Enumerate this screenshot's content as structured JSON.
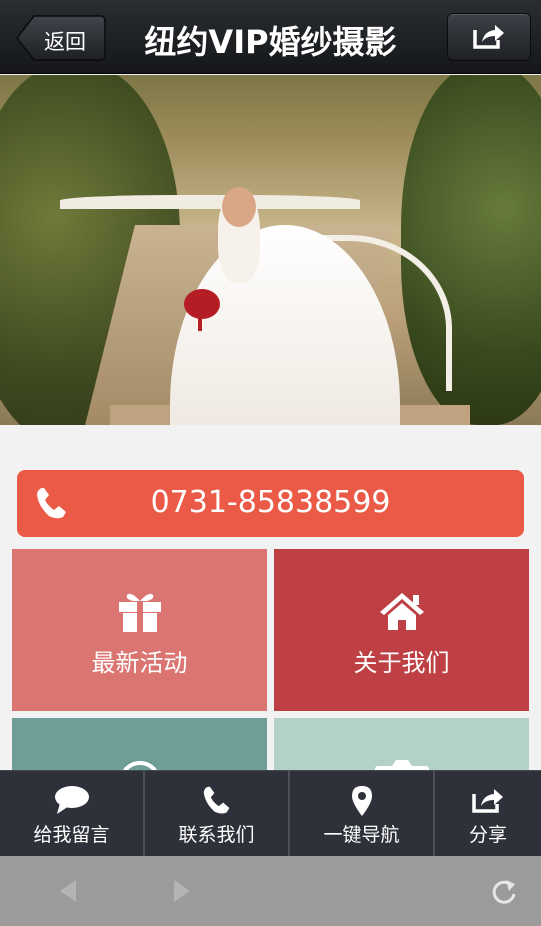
{
  "header": {
    "back_label": "返回",
    "title": "纽约VIP婚纱摄影",
    "share_icon": "share-icon"
  },
  "carousel": {
    "slide_count": 5,
    "active_index": 3
  },
  "phone": {
    "icon": "phone-icon",
    "number": "0731-85838599",
    "color": "#ea5a47"
  },
  "tiles": [
    {
      "label": "最新活动",
      "icon": "gift-icon",
      "color": "#db7571"
    },
    {
      "label": "关于我们",
      "icon": "home-icon",
      "color": "#be4044"
    },
    {
      "label": "",
      "icon": "smiley-icon",
      "color": "#6f9d97"
    },
    {
      "label": "",
      "icon": "camera-icon",
      "color": "#b3d1c4"
    }
  ],
  "bottom_nav": {
    "items": [
      {
        "label": "给我留言",
        "icon": "comment-icon"
      },
      {
        "label": "联系我们",
        "icon": "phone-icon"
      },
      {
        "label": "一键导航",
        "icon": "map-pin-icon"
      },
      {
        "label": "分享",
        "icon": "share-icon"
      }
    ]
  },
  "browser": {
    "back_icon": "back-arrow-icon",
    "forward_icon": "forward-arrow-icon",
    "refresh_icon": "refresh-icon"
  }
}
